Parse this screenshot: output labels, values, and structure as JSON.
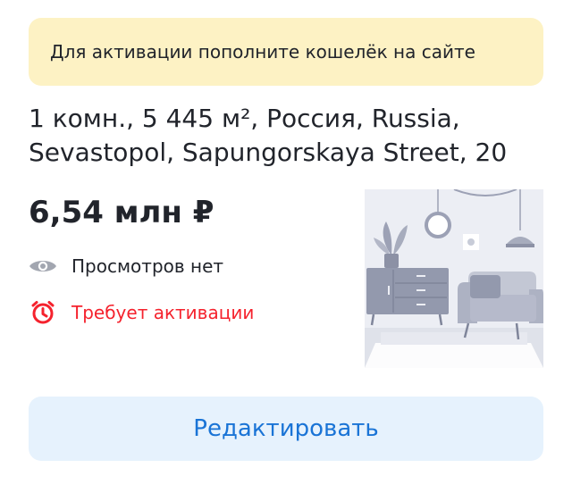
{
  "notice": {
    "text": "Для активации пополните кошелёк на сайте"
  },
  "listing": {
    "address_line1": "1 комн., 5 445 м², Россия, Russia,",
    "address_line2": "Sevastopol, Sapungorskaya Street, 20",
    "price": "6,54 млн ₽",
    "views_text": "Просмотров нет",
    "status_text": "Требует активации",
    "photo_icon": "interior-placeholder-illustration"
  },
  "actions": {
    "edit_label": "Редактировать"
  },
  "colors": {
    "notice_bg": "#fdf2c4",
    "status_red": "#f5222d",
    "button_bg": "#e6f2fd",
    "button_text": "#1a74d6"
  },
  "icons": {
    "views": "eye-icon",
    "status": "alarm-clock-icon"
  }
}
